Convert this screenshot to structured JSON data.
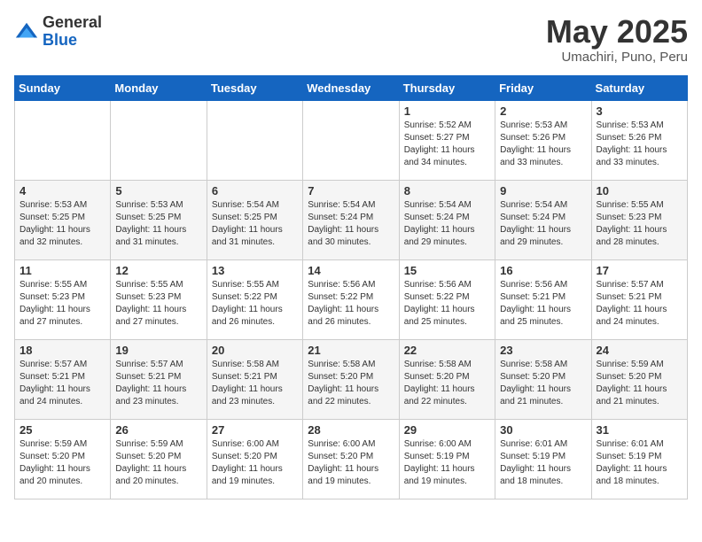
{
  "logo": {
    "general": "General",
    "blue": "Blue"
  },
  "title": "May 2025",
  "subtitle": "Umachiri, Puno, Peru",
  "weekdays": [
    "Sunday",
    "Monday",
    "Tuesday",
    "Wednesday",
    "Thursday",
    "Friday",
    "Saturday"
  ],
  "weeks": [
    [
      {
        "num": "",
        "info": ""
      },
      {
        "num": "",
        "info": ""
      },
      {
        "num": "",
        "info": ""
      },
      {
        "num": "",
        "info": ""
      },
      {
        "num": "1",
        "info": "Sunrise: 5:52 AM\nSunset: 5:27 PM\nDaylight: 11 hours\nand 34 minutes."
      },
      {
        "num": "2",
        "info": "Sunrise: 5:53 AM\nSunset: 5:26 PM\nDaylight: 11 hours\nand 33 minutes."
      },
      {
        "num": "3",
        "info": "Sunrise: 5:53 AM\nSunset: 5:26 PM\nDaylight: 11 hours\nand 33 minutes."
      }
    ],
    [
      {
        "num": "4",
        "info": "Sunrise: 5:53 AM\nSunset: 5:25 PM\nDaylight: 11 hours\nand 32 minutes."
      },
      {
        "num": "5",
        "info": "Sunrise: 5:53 AM\nSunset: 5:25 PM\nDaylight: 11 hours\nand 31 minutes."
      },
      {
        "num": "6",
        "info": "Sunrise: 5:54 AM\nSunset: 5:25 PM\nDaylight: 11 hours\nand 31 minutes."
      },
      {
        "num": "7",
        "info": "Sunrise: 5:54 AM\nSunset: 5:24 PM\nDaylight: 11 hours\nand 30 minutes."
      },
      {
        "num": "8",
        "info": "Sunrise: 5:54 AM\nSunset: 5:24 PM\nDaylight: 11 hours\nand 29 minutes."
      },
      {
        "num": "9",
        "info": "Sunrise: 5:54 AM\nSunset: 5:24 PM\nDaylight: 11 hours\nand 29 minutes."
      },
      {
        "num": "10",
        "info": "Sunrise: 5:55 AM\nSunset: 5:23 PM\nDaylight: 11 hours\nand 28 minutes."
      }
    ],
    [
      {
        "num": "11",
        "info": "Sunrise: 5:55 AM\nSunset: 5:23 PM\nDaylight: 11 hours\nand 27 minutes."
      },
      {
        "num": "12",
        "info": "Sunrise: 5:55 AM\nSunset: 5:23 PM\nDaylight: 11 hours\nand 27 minutes."
      },
      {
        "num": "13",
        "info": "Sunrise: 5:55 AM\nSunset: 5:22 PM\nDaylight: 11 hours\nand 26 minutes."
      },
      {
        "num": "14",
        "info": "Sunrise: 5:56 AM\nSunset: 5:22 PM\nDaylight: 11 hours\nand 26 minutes."
      },
      {
        "num": "15",
        "info": "Sunrise: 5:56 AM\nSunset: 5:22 PM\nDaylight: 11 hours\nand 25 minutes."
      },
      {
        "num": "16",
        "info": "Sunrise: 5:56 AM\nSunset: 5:21 PM\nDaylight: 11 hours\nand 25 minutes."
      },
      {
        "num": "17",
        "info": "Sunrise: 5:57 AM\nSunset: 5:21 PM\nDaylight: 11 hours\nand 24 minutes."
      }
    ],
    [
      {
        "num": "18",
        "info": "Sunrise: 5:57 AM\nSunset: 5:21 PM\nDaylight: 11 hours\nand 24 minutes."
      },
      {
        "num": "19",
        "info": "Sunrise: 5:57 AM\nSunset: 5:21 PM\nDaylight: 11 hours\nand 23 minutes."
      },
      {
        "num": "20",
        "info": "Sunrise: 5:58 AM\nSunset: 5:21 PM\nDaylight: 11 hours\nand 23 minutes."
      },
      {
        "num": "21",
        "info": "Sunrise: 5:58 AM\nSunset: 5:20 PM\nDaylight: 11 hours\nand 22 minutes."
      },
      {
        "num": "22",
        "info": "Sunrise: 5:58 AM\nSunset: 5:20 PM\nDaylight: 11 hours\nand 22 minutes."
      },
      {
        "num": "23",
        "info": "Sunrise: 5:58 AM\nSunset: 5:20 PM\nDaylight: 11 hours\nand 21 minutes."
      },
      {
        "num": "24",
        "info": "Sunrise: 5:59 AM\nSunset: 5:20 PM\nDaylight: 11 hours\nand 21 minutes."
      }
    ],
    [
      {
        "num": "25",
        "info": "Sunrise: 5:59 AM\nSunset: 5:20 PM\nDaylight: 11 hours\nand 20 minutes."
      },
      {
        "num": "26",
        "info": "Sunrise: 5:59 AM\nSunset: 5:20 PM\nDaylight: 11 hours\nand 20 minutes."
      },
      {
        "num": "27",
        "info": "Sunrise: 6:00 AM\nSunset: 5:20 PM\nDaylight: 11 hours\nand 19 minutes."
      },
      {
        "num": "28",
        "info": "Sunrise: 6:00 AM\nSunset: 5:20 PM\nDaylight: 11 hours\nand 19 minutes."
      },
      {
        "num": "29",
        "info": "Sunrise: 6:00 AM\nSunset: 5:19 PM\nDaylight: 11 hours\nand 19 minutes."
      },
      {
        "num": "30",
        "info": "Sunrise: 6:01 AM\nSunset: 5:19 PM\nDaylight: 11 hours\nand 18 minutes."
      },
      {
        "num": "31",
        "info": "Sunrise: 6:01 AM\nSunset: 5:19 PM\nDaylight: 11 hours\nand 18 minutes."
      }
    ]
  ]
}
